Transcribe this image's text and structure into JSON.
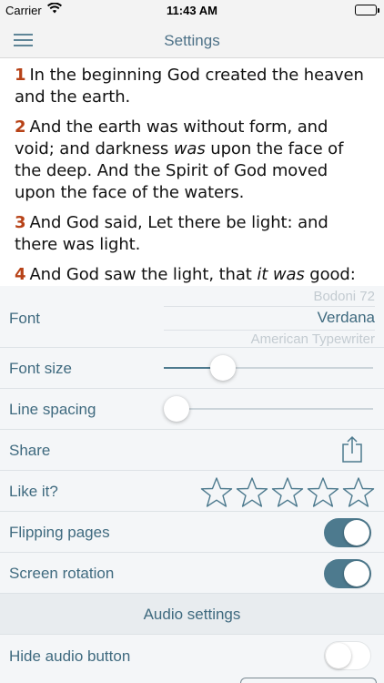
{
  "status": {
    "carrier": "Carrier",
    "time": "11:43 AM"
  },
  "nav": {
    "title": "Settings"
  },
  "reader": {
    "verses": [
      {
        "num": "1",
        "parts": [
          {
            "t": "In the beginning God created the heaven and the earth."
          }
        ]
      },
      {
        "num": "2",
        "parts": [
          {
            "t": "And the earth was without form, and void; and darkness "
          },
          {
            "t": "was",
            "i": true
          },
          {
            "t": " upon the face of the deep. And the Spirit of God moved upon the face of the waters."
          }
        ]
      },
      {
        "num": "3",
        "parts": [
          {
            "t": "And God said, Let there be light: and there was light."
          }
        ]
      },
      {
        "num": "4",
        "parts": [
          {
            "t": "And God saw the light, that "
          },
          {
            "t": "it was",
            "i": true
          },
          {
            "t": " good: and God divided the light from the darkness."
          }
        ]
      }
    ]
  },
  "settings": {
    "font": {
      "label": "Font",
      "options": [
        "Bodoni 72",
        "Verdana",
        "American Typewriter"
      ],
      "selected": "Verdana"
    },
    "font_size": {
      "label": "Font size",
      "value": 0.25
    },
    "line_spacing": {
      "label": "Line spacing",
      "value": 0.0
    },
    "share": {
      "label": "Share",
      "icon": "share-icon"
    },
    "like": {
      "label": "Like it?",
      "stars_total": 5,
      "stars_filled": 0,
      "icon": "star-outline-icon"
    },
    "flipping_pages": {
      "label": "Flipping pages",
      "on": true
    },
    "screen_rotation": {
      "label": "Screen rotation",
      "on": true
    },
    "audio_header": "Audio settings",
    "hide_audio": {
      "label": "Hide audio button",
      "on": false
    }
  },
  "colors": {
    "accent": "#4d7a8e",
    "verse_number": "#b74217",
    "label": "#3f6a7f"
  }
}
